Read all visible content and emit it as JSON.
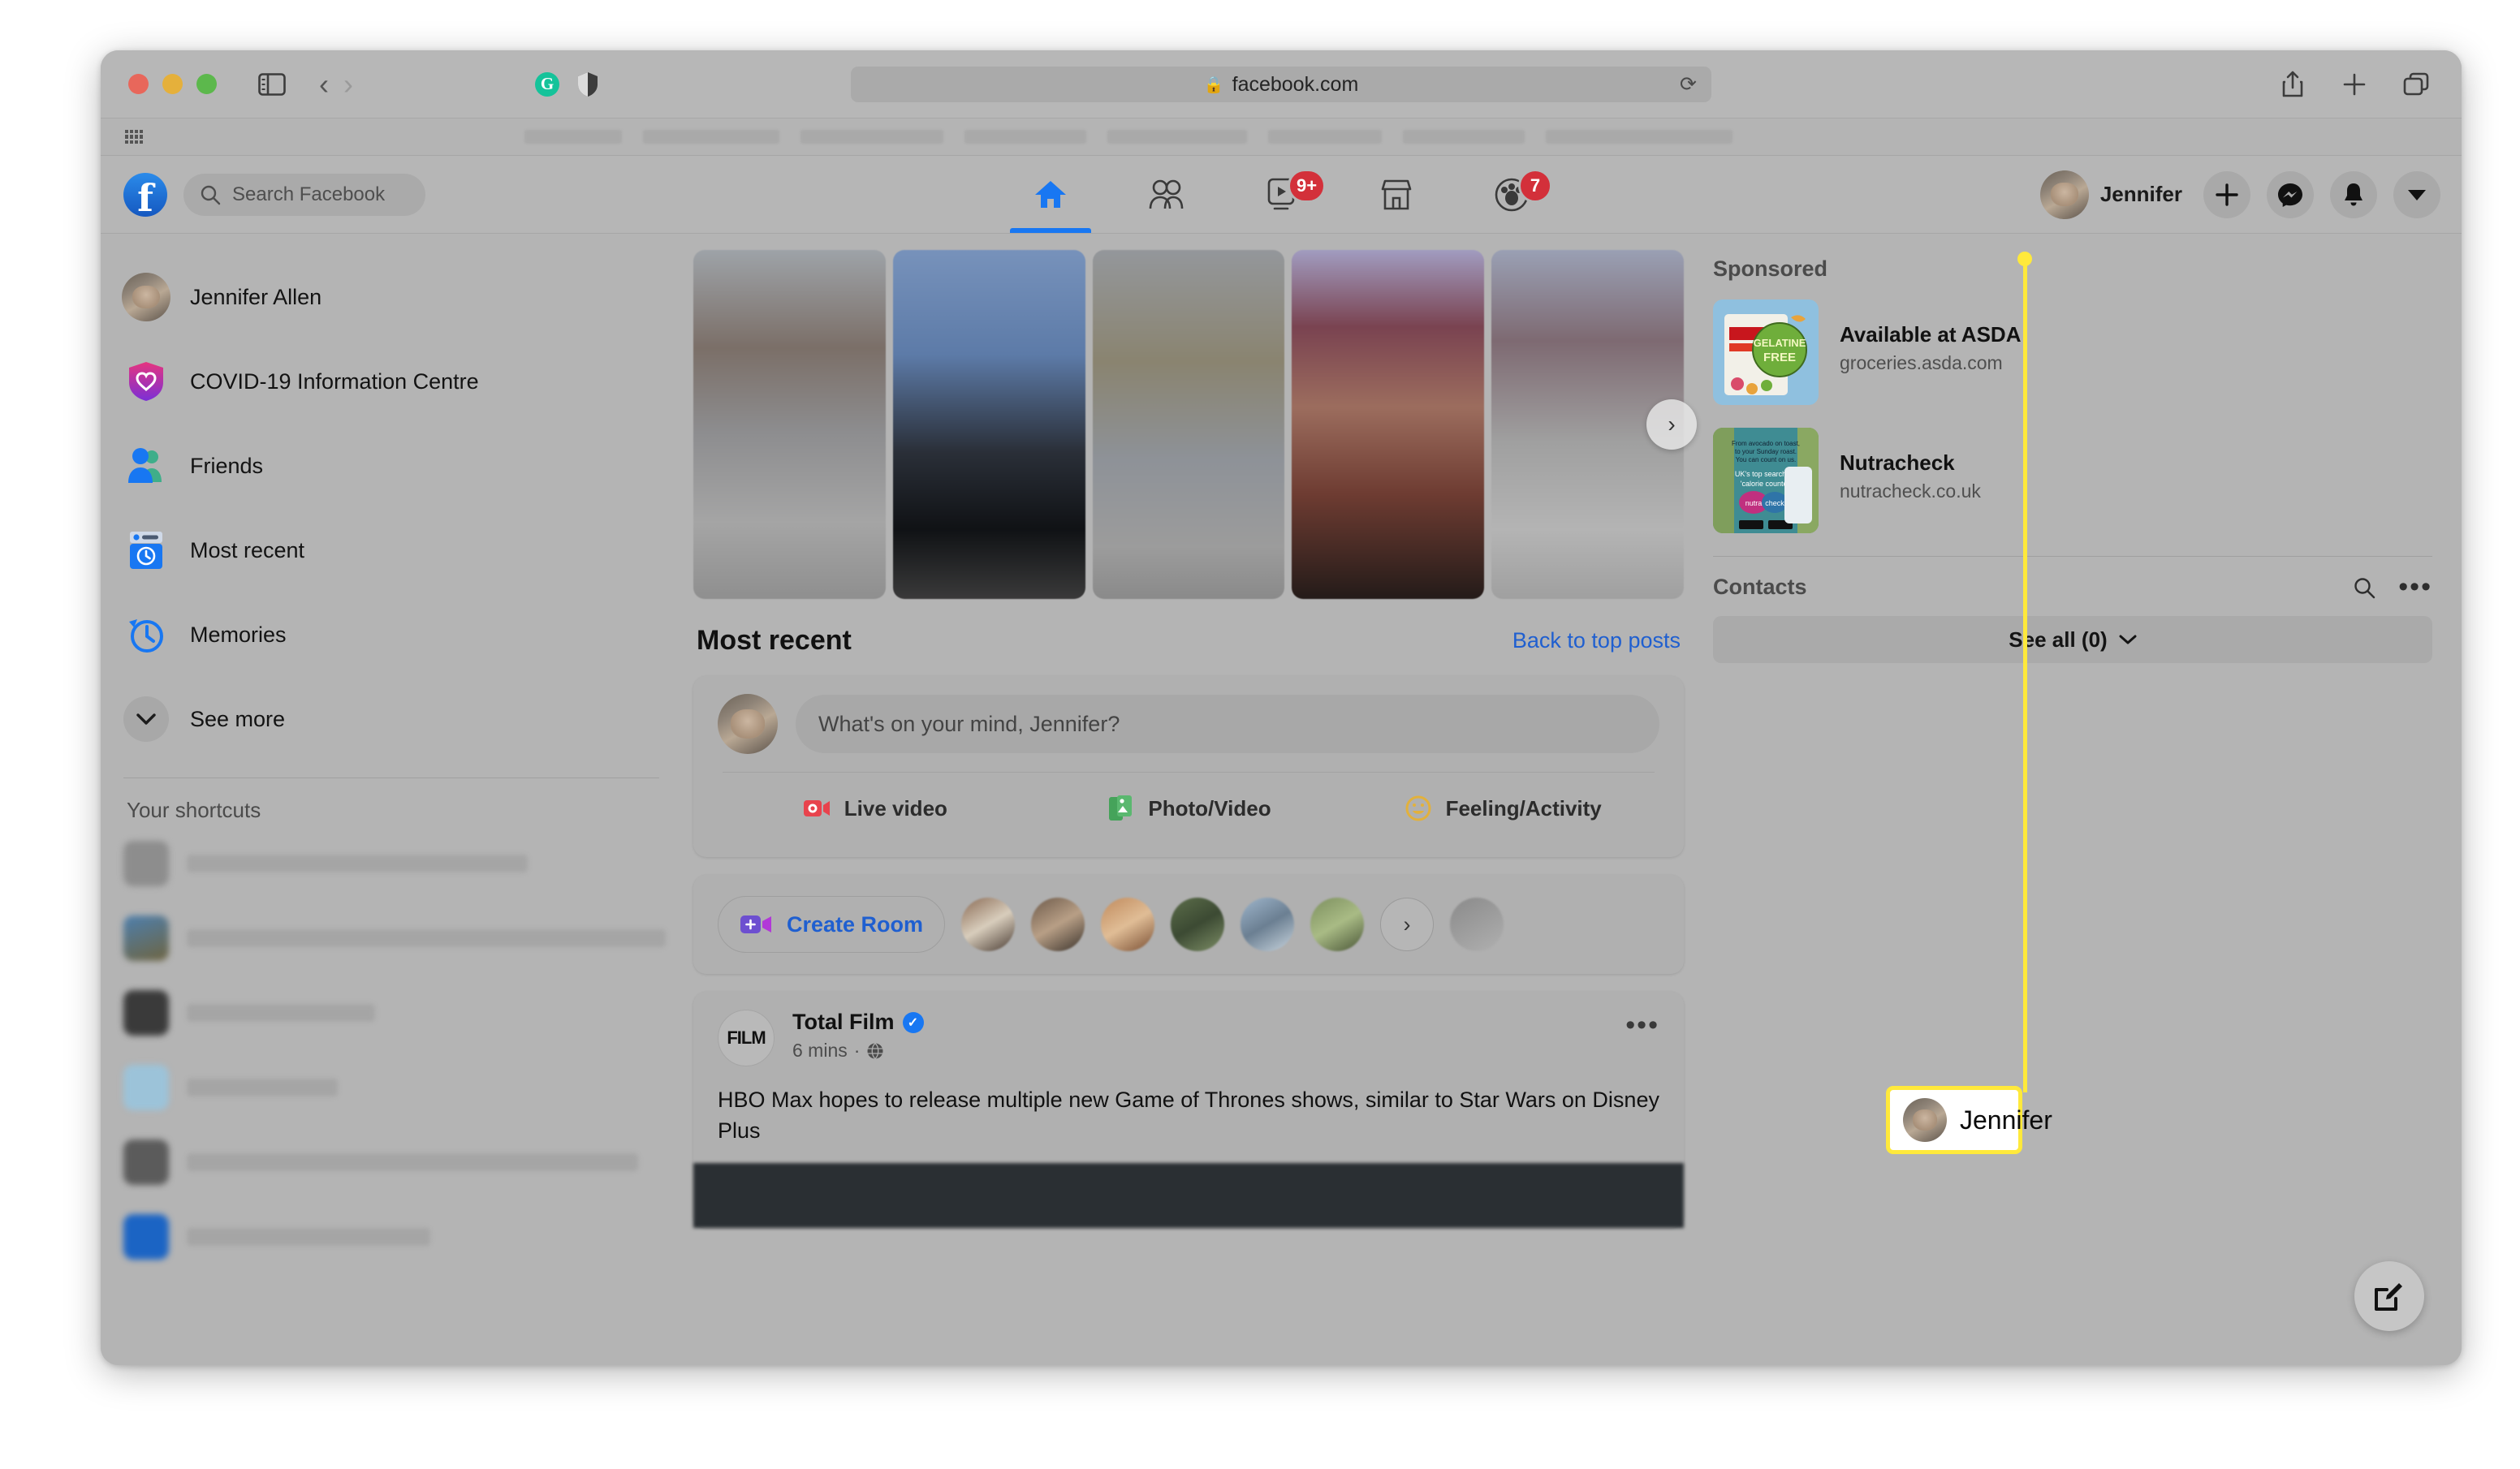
{
  "browser": {
    "url_domain": "facebook.com",
    "lock_icon": "lock-icon",
    "reload_icon": "reload-icon",
    "sidebar_icon": "sidebar-toggle-icon",
    "back_icon": "chevron-left-icon",
    "forward_icon": "chevron-right-icon",
    "grammarly_icon": "G",
    "shield_icon": "shield-icon",
    "share_icon": "share-icon",
    "newtab_icon": "plus-icon",
    "tabs_icon": "tab-overview-icon"
  },
  "topnav": {
    "logo": "f",
    "search_placeholder": "Search Facebook",
    "search_icon": "search-icon",
    "tabs": [
      {
        "name": "home",
        "icon": "home-icon",
        "active": true,
        "badge": ""
      },
      {
        "name": "friends",
        "icon": "friends-icon",
        "active": false,
        "badge": ""
      },
      {
        "name": "watch",
        "icon": "watch-icon",
        "active": false,
        "badge": "9+"
      },
      {
        "name": "marketplace",
        "icon": "marketplace-icon",
        "active": false,
        "badge": ""
      },
      {
        "name": "groups",
        "icon": "groups-icon",
        "active": false,
        "badge": "7"
      }
    ],
    "profile_name": "Jennifer",
    "plus_icon": "plus-icon",
    "messenger_icon": "messenger-icon",
    "notifications_icon": "bell-icon",
    "account_icon": "chevron-down-icon"
  },
  "sidebar": {
    "items": [
      {
        "label": "Jennifer Allen",
        "icon": "user-avatar"
      },
      {
        "label": "COVID-19 Information Centre",
        "icon": "covid-shield-icon"
      },
      {
        "label": "Friends",
        "icon": "friends-icon"
      },
      {
        "label": "Most recent",
        "icon": "most-recent-icon"
      },
      {
        "label": "Memories",
        "icon": "memories-clock-icon"
      },
      {
        "label": "See more",
        "icon": "chevron-down-icon"
      }
    ],
    "shortcuts_title": "Your shortcuts"
  },
  "feed": {
    "heading": "Most recent",
    "back_link": "Back to top posts",
    "composer": {
      "placeholder": "What's on your mind, Jennifer?",
      "actions": [
        {
          "label": "Live video",
          "icon": "live-video-icon",
          "color": "#e8434d"
        },
        {
          "label": "Photo/Video",
          "icon": "photo-video-icon",
          "color": "#45a35a"
        },
        {
          "label": "Feeling/Activity",
          "icon": "feeling-activity-icon",
          "color": "#e2b13c"
        }
      ]
    },
    "room": {
      "create_label": "Create Room",
      "create_icon": "video-plus-icon",
      "next_icon": "chevron-right-icon"
    },
    "post": {
      "page_logo_text": "FILM",
      "page_name": "Total Film",
      "verified_icon": "verified-badge-icon",
      "timestamp": "6 mins",
      "audience_icon": "globe-icon",
      "menu_icon": "more-options-icon",
      "text": "HBO Max hopes to release multiple new Game of Thrones shows, similar to Star Wars on Disney Plus"
    }
  },
  "right": {
    "sponsored_title": "Sponsored",
    "ads": [
      {
        "title": "Available at ASDA",
        "url": "groceries.asda.com"
      },
      {
        "title": "Nutracheck",
        "url": "nutracheck.co.uk"
      }
    ],
    "contacts_title": "Contacts",
    "contacts_search_icon": "search-icon",
    "contacts_menu_icon": "more-options-icon",
    "see_all_label": "See all (0)",
    "see_all_chevron": "chevron-down-icon"
  },
  "callout": {
    "name": "Jennifer",
    "highlight_color": "#ffe93b"
  },
  "fab": {
    "icon": "compose-pencil-icon"
  }
}
